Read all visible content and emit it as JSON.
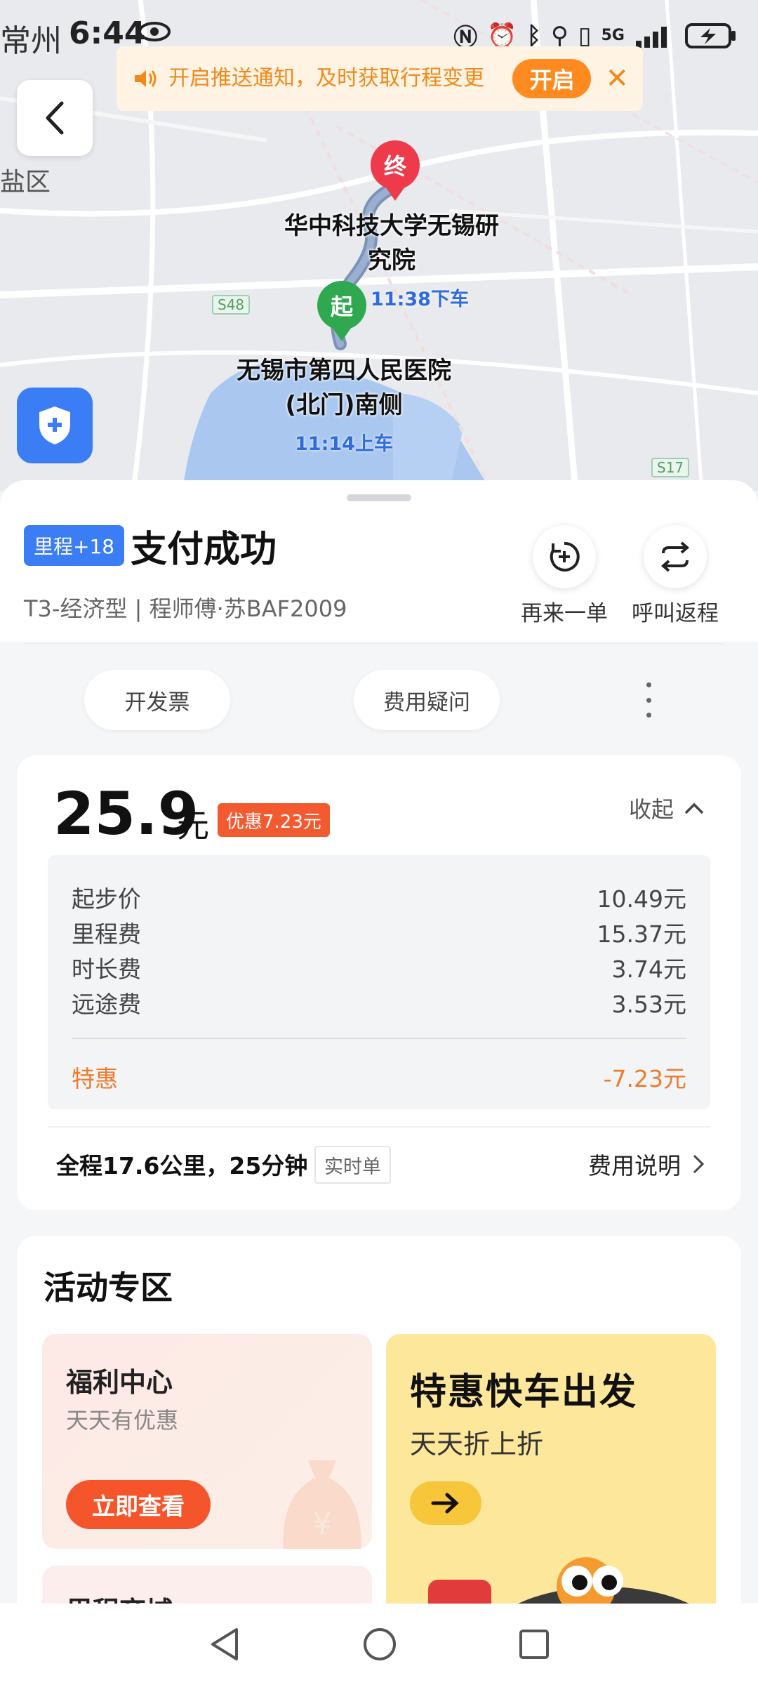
{
  "status": {
    "city": "常州",
    "time": "6:44",
    "network": "5G"
  },
  "notify": {
    "text": "开启推送通知，及时获取行程变更",
    "button": "开启"
  },
  "map": {
    "district": "盐区",
    "end_pin": "终",
    "start_pin": "起",
    "end_label": "华中科技大学无锡研究院",
    "end_time": "11:38下车",
    "start_label": "无锡市第四人民医院(北门)南侧",
    "start_time": "11:14上车",
    "roads": [
      "S48",
      "S17"
    ]
  },
  "trip": {
    "mileage_badge": "里程+18",
    "title": "支付成功",
    "subtitle": "T3-经济型 | 程师傅·苏BAF2009",
    "reorder": "再来一单",
    "return_trip": "呼叫返程"
  },
  "pills": {
    "invoice": "开发票",
    "fee_question": "费用疑问"
  },
  "fare": {
    "amount": "25.9",
    "unit": "元",
    "discount": "优惠7.23元",
    "collapse": "收起",
    "items": [
      {
        "name": "起步价",
        "value": "10.49元"
      },
      {
        "name": "里程费",
        "value": "15.37元"
      },
      {
        "name": "时长费",
        "value": "3.74元"
      },
      {
        "name": "远途费",
        "value": "3.53元"
      }
    ],
    "special_name": "特惠",
    "special_value": "-7.23元",
    "summary": "全程17.6公里，25分钟",
    "realtime_tag": "实时单",
    "fee_explain": "费用说明"
  },
  "activity": {
    "title": "活动专区",
    "welfare_title": "福利中心",
    "welfare_sub": "天天有优惠",
    "welfare_btn": "立即查看",
    "mall_title": "里程商城",
    "promo_title": "特惠快车出发",
    "promo_sub": "天天折上折"
  },
  "colors": {
    "brand_blue": "#3b7df5",
    "orange": "#f5552b",
    "promo_yellow": "#fde79a"
  }
}
